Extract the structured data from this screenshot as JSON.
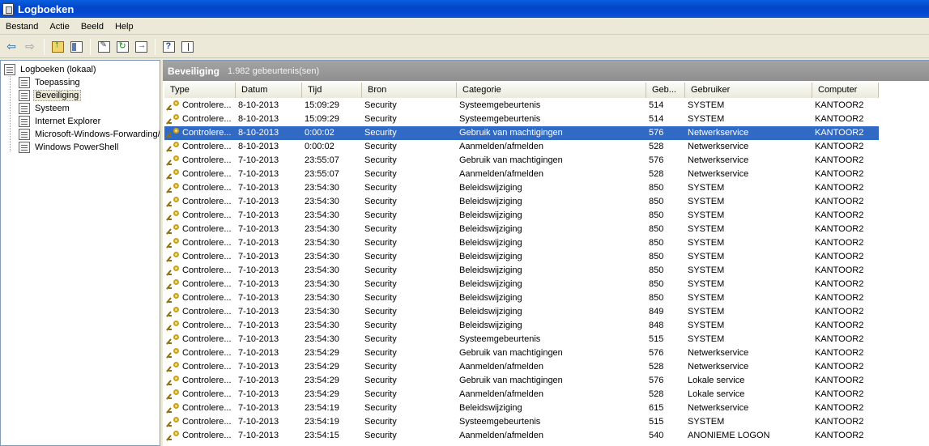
{
  "window": {
    "title": "Logboeken"
  },
  "menu": [
    "Bestand",
    "Actie",
    "Beeld",
    "Help"
  ],
  "tree": {
    "root": "Logboeken (lokaal)",
    "items": [
      "Toepassing",
      "Beveiliging",
      "Systeem",
      "Internet Explorer",
      "Microsoft-Windows-Forwarding/",
      "Windows PowerShell"
    ],
    "selected": "Beveiliging"
  },
  "panel": {
    "title": "Beveiliging",
    "count": "1.982 gebeurtenis(sen)"
  },
  "columns": [
    "Type",
    "Datum",
    "Tijd",
    "Bron",
    "Categorie",
    "Geb...",
    "Gebruiker",
    "Computer"
  ],
  "rows": [
    [
      "Controlere...",
      "8-10-2013",
      "15:09:29",
      "Security",
      "Systeemgebeurtenis",
      "514",
      "SYSTEM",
      "KANTOOR2"
    ],
    [
      "Controlere...",
      "8-10-2013",
      "15:09:29",
      "Security",
      "Systeemgebeurtenis",
      "514",
      "SYSTEM",
      "KANTOOR2"
    ],
    [
      "Controlere...",
      "8-10-2013",
      "0:00:02",
      "Security",
      "Gebruik van machtigingen",
      "576",
      "Netwerkservice",
      "KANTOOR2"
    ],
    [
      "Controlere...",
      "8-10-2013",
      "0:00:02",
      "Security",
      "Aanmelden/afmelden",
      "528",
      "Netwerkservice",
      "KANTOOR2"
    ],
    [
      "Controlere...",
      "7-10-2013",
      "23:55:07",
      "Security",
      "Gebruik van machtigingen",
      "576",
      "Netwerkservice",
      "KANTOOR2"
    ],
    [
      "Controlere...",
      "7-10-2013",
      "23:55:07",
      "Security",
      "Aanmelden/afmelden",
      "528",
      "Netwerkservice",
      "KANTOOR2"
    ],
    [
      "Controlere...",
      "7-10-2013",
      "23:54:30",
      "Security",
      "Beleidswijziging",
      "850",
      "SYSTEM",
      "KANTOOR2"
    ],
    [
      "Controlere...",
      "7-10-2013",
      "23:54:30",
      "Security",
      "Beleidswijziging",
      "850",
      "SYSTEM",
      "KANTOOR2"
    ],
    [
      "Controlere...",
      "7-10-2013",
      "23:54:30",
      "Security",
      "Beleidswijziging",
      "850",
      "SYSTEM",
      "KANTOOR2"
    ],
    [
      "Controlere...",
      "7-10-2013",
      "23:54:30",
      "Security",
      "Beleidswijziging",
      "850",
      "SYSTEM",
      "KANTOOR2"
    ],
    [
      "Controlere...",
      "7-10-2013",
      "23:54:30",
      "Security",
      "Beleidswijziging",
      "850",
      "SYSTEM",
      "KANTOOR2"
    ],
    [
      "Controlere...",
      "7-10-2013",
      "23:54:30",
      "Security",
      "Beleidswijziging",
      "850",
      "SYSTEM",
      "KANTOOR2"
    ],
    [
      "Controlere...",
      "7-10-2013",
      "23:54:30",
      "Security",
      "Beleidswijziging",
      "850",
      "SYSTEM",
      "KANTOOR2"
    ],
    [
      "Controlere...",
      "7-10-2013",
      "23:54:30",
      "Security",
      "Beleidswijziging",
      "850",
      "SYSTEM",
      "KANTOOR2"
    ],
    [
      "Controlere...",
      "7-10-2013",
      "23:54:30",
      "Security",
      "Beleidswijziging",
      "850",
      "SYSTEM",
      "KANTOOR2"
    ],
    [
      "Controlere...",
      "7-10-2013",
      "23:54:30",
      "Security",
      "Beleidswijziging",
      "849",
      "SYSTEM",
      "KANTOOR2"
    ],
    [
      "Controlere...",
      "7-10-2013",
      "23:54:30",
      "Security",
      "Beleidswijziging",
      "848",
      "SYSTEM",
      "KANTOOR2"
    ],
    [
      "Controlere...",
      "7-10-2013",
      "23:54:30",
      "Security",
      "Systeemgebeurtenis",
      "515",
      "SYSTEM",
      "KANTOOR2"
    ],
    [
      "Controlere...",
      "7-10-2013",
      "23:54:29",
      "Security",
      "Gebruik van machtigingen",
      "576",
      "Netwerkservice",
      "KANTOOR2"
    ],
    [
      "Controlere...",
      "7-10-2013",
      "23:54:29",
      "Security",
      "Aanmelden/afmelden",
      "528",
      "Netwerkservice",
      "KANTOOR2"
    ],
    [
      "Controlere...",
      "7-10-2013",
      "23:54:29",
      "Security",
      "Gebruik van machtigingen",
      "576",
      "Lokale service",
      "KANTOOR2"
    ],
    [
      "Controlere...",
      "7-10-2013",
      "23:54:29",
      "Security",
      "Aanmelden/afmelden",
      "528",
      "Lokale service",
      "KANTOOR2"
    ],
    [
      "Controlere...",
      "7-10-2013",
      "23:54:19",
      "Security",
      "Beleidswijziging",
      "615",
      "Netwerkservice",
      "KANTOOR2"
    ],
    [
      "Controlere...",
      "7-10-2013",
      "23:54:19",
      "Security",
      "Systeemgebeurtenis",
      "515",
      "SYSTEM",
      "KANTOOR2"
    ],
    [
      "Controlere...",
      "7-10-2013",
      "23:54:15",
      "Security",
      "Aanmelden/afmelden",
      "540",
      "ANONIEME LOGON",
      "KANTOOR2"
    ]
  ],
  "selected_row": 2,
  "colors": {
    "selection": "#316ac5",
    "titlebar": "#0448d0"
  }
}
